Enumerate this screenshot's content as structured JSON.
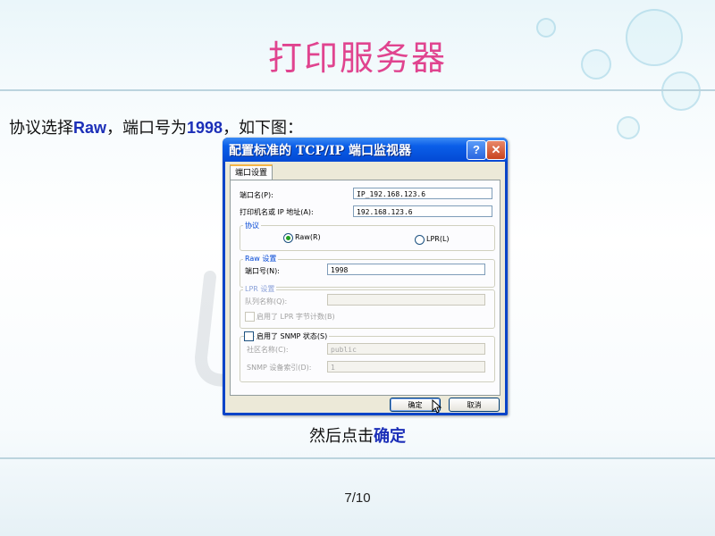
{
  "slide": {
    "title": "打印服务器",
    "intro": {
      "prefix": "协议选择",
      "protocol": "Raw",
      "mid": "，端口号为",
      "port": "1998",
      "suffix": "，如下图："
    },
    "caption": {
      "prefix": "然后点击",
      "action": "确定"
    },
    "page_number": "7/10"
  },
  "dialog": {
    "title": "配置标准的 TCP/IP 端口监视器",
    "help_label": "?",
    "close_label": "✕",
    "tab_label": "端口设置",
    "port_name_label": "端口名(P):",
    "port_name_value": "IP_192.168.123.6",
    "printer_address_label": "打印机名或 IP 地址(A):",
    "printer_address_value": "192.168.123.6",
    "protocol_group_label": "协议",
    "raw_radio_label": "Raw(R)",
    "lpr_radio_label": "LPR(L)",
    "raw_group_label": "Raw 设置",
    "port_number_label": "端口号(N):",
    "port_number_value": "1998",
    "lpr_group_label": "LPR 设置",
    "queue_name_label": "队列名称(Q):",
    "queue_name_value": "",
    "lpr_byte_count_label": "启用了 LPR 字节计数(B)",
    "snmp_enabled_label": "启用了 SNMP 状态(S)",
    "community_name_label": "社区名称(C):",
    "community_name_value": "public",
    "snmp_device_index_label": "SNMP 设备索引(D):",
    "snmp_device_index_value": "1",
    "ok_label": "确定",
    "cancel_label": "取消"
  },
  "colors": {
    "title": "#e0448f",
    "highlight": "#1c2fb8",
    "xp_title_bar": "#0a5ee8",
    "group_title": "#0046d5"
  }
}
